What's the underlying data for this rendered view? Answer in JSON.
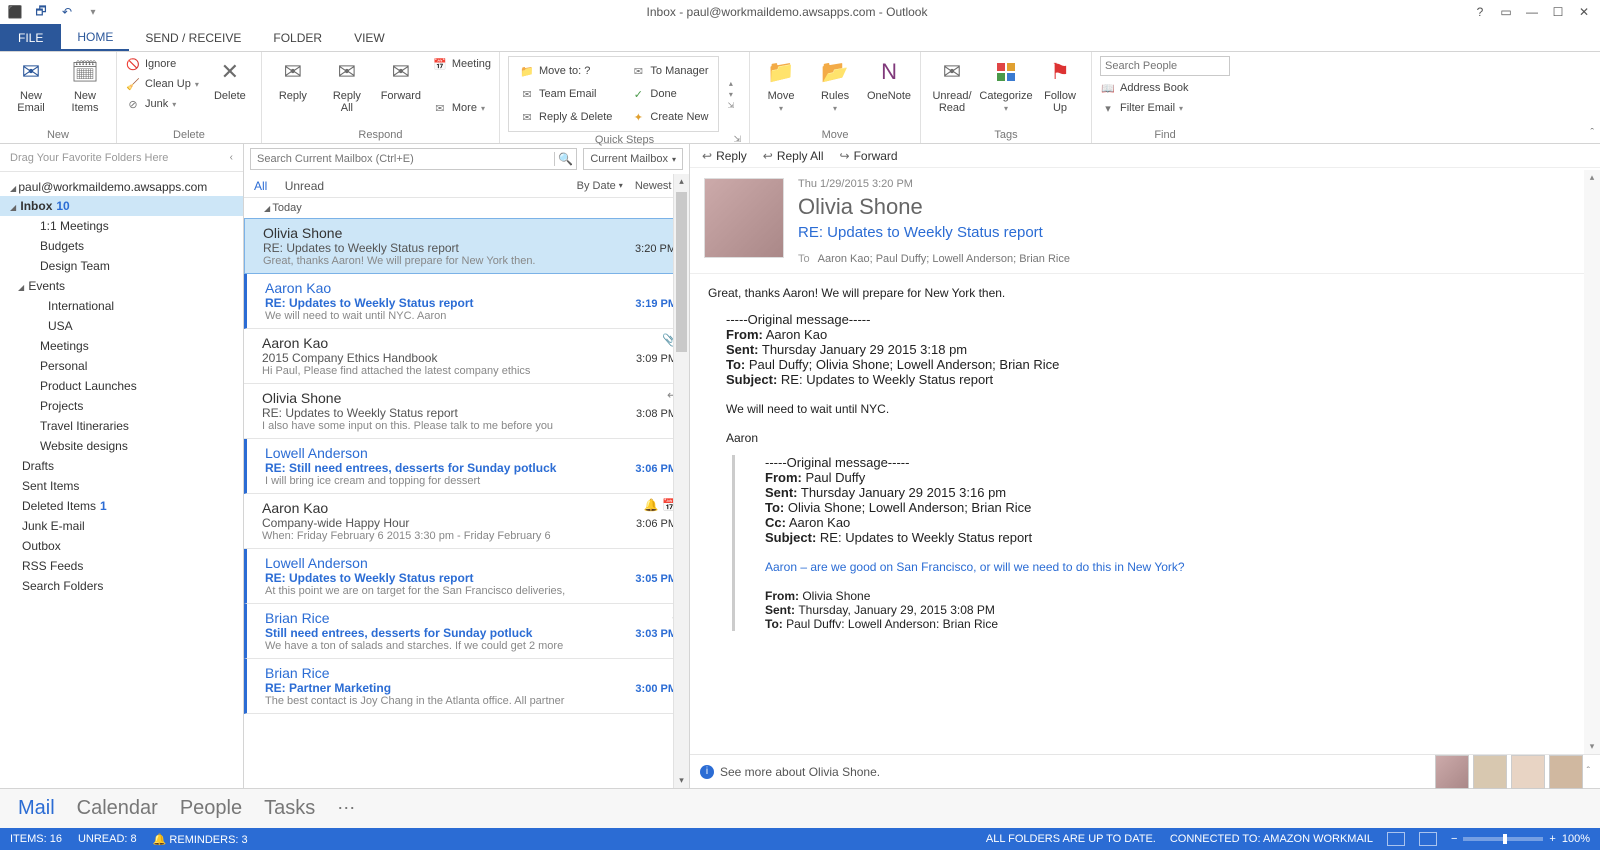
{
  "title": "Inbox - paul@workmaildemo.awsapps.com - Outlook",
  "tabs": {
    "file": "FILE",
    "home": "HOME",
    "sendrecv": "SEND / RECEIVE",
    "folder": "FOLDER",
    "view": "VIEW"
  },
  "ribbon": {
    "new": {
      "grp": "New",
      "email": "New\nEmail",
      "items": "New\nItems"
    },
    "delete": {
      "grp": "Delete",
      "ignore": "Ignore",
      "cleanup": "Clean Up",
      "junk": "Junk",
      "delete": "Delete"
    },
    "respond": {
      "grp": "Respond",
      "reply": "Reply",
      "replyall": "Reply\nAll",
      "forward": "Forward",
      "meeting": "Meeting",
      "more": "More"
    },
    "qs": {
      "grp": "Quick Steps",
      "move": "Move to: ?",
      "manager": "To Manager",
      "team": "Team Email",
      "done": "Done",
      "replydel": "Reply & Delete",
      "create": "Create New"
    },
    "move": {
      "grp": "Move",
      "move": "Move",
      "rules": "Rules",
      "onenote": "OneNote"
    },
    "tags": {
      "grp": "Tags",
      "unread": "Unread/\nRead",
      "cat": "Categorize",
      "follow": "Follow\nUp"
    },
    "find": {
      "grp": "Find",
      "searchph": "Search People",
      "addr": "Address Book",
      "filter": "Filter Email"
    }
  },
  "nav": {
    "fav": "Drag Your Favorite Folders Here",
    "account": "paul@workmaildemo.awsapps.com",
    "inbox": "Inbox",
    "inbox_cnt": "10",
    "subs": [
      "1:1 Meetings",
      "Budgets",
      "Design Team"
    ],
    "events": "Events",
    "events_children": [
      "International",
      "USA"
    ],
    "subs2": [
      "Meetings",
      "Personal",
      "Product Launches",
      "Projects",
      "Travel Itineraries",
      "Website designs"
    ],
    "drafts": "Drafts",
    "sent": "Sent Items",
    "deleted": "Deleted Items",
    "deleted_cnt": "1",
    "junk": "Junk E-mail",
    "outbox": "Outbox",
    "rss": "RSS Feeds",
    "search": "Search Folders"
  },
  "list": {
    "searchph": "Search Current Mailbox (Ctrl+E)",
    "scope": "Current Mailbox",
    "all": "All",
    "unread": "Unread",
    "bydate": "By Date",
    "newest": "Newest",
    "group": "Today",
    "msgs": [
      {
        "from": "Olivia Shone",
        "subj": "RE: Updates to Weekly Status report",
        "prev": "Great, thanks Aaron! We will prepare for New York then.",
        "time": "3:20 PM",
        "sel": true
      },
      {
        "from": "Aaron Kao",
        "subj": "RE: Updates to Weekly Status report",
        "prev": "We will need to wait until NYC.   Aaron",
        "time": "3:19 PM",
        "unread": true
      },
      {
        "from": "Aaron Kao",
        "subj": "2015 Company Ethics Handbook",
        "prev": "Hi Paul,  Please find attached the latest company ethics",
        "time": "3:09 PM",
        "badge": "📎"
      },
      {
        "from": "Olivia Shone",
        "subj": "RE: Updates to Weekly Status report",
        "prev": "I also have some input on this.  Please talk to me before you",
        "time": "3:08 PM",
        "badge": "↩"
      },
      {
        "from": "Lowell Anderson",
        "subj": "RE: Still need entrees, desserts for Sunday potluck",
        "prev": "I will bring ice cream and topping for dessert",
        "time": "3:06 PM",
        "unread": true
      },
      {
        "from": "Aaron Kao",
        "subj": "Company-wide Happy Hour",
        "prev": "When: Friday February 6 2015 3:30 pm - Friday February 6",
        "time": "3:06 PM",
        "badge": "🔔 📅"
      },
      {
        "from": "Lowell Anderson",
        "subj": "RE: Updates to Weekly Status report",
        "prev": "At this point we are on target for the San Francisco deliveries,",
        "time": "3:05 PM",
        "unread": true
      },
      {
        "from": "Brian Rice",
        "subj": "Still need entrees, desserts for Sunday potluck",
        "prev": "We have a ton of salads and starches. If we could get 2 more",
        "time": "3:03 PM",
        "unread": true,
        "badge": "↓"
      },
      {
        "from": "Brian Rice",
        "subj": "RE: Partner Marketing",
        "prev": "The best contact is Joy Chang in the Atlanta office. All partner",
        "time": "3:00 PM",
        "unread": true
      }
    ]
  },
  "reading": {
    "actions": {
      "reply": "Reply",
      "replyall": "Reply All",
      "forward": "Forward"
    },
    "date": "Thu 1/29/2015 3:20 PM",
    "sender": "Olivia Shone",
    "subject": "RE: Updates to Weekly Status report",
    "to_label": "To",
    "to": "Aaron Kao; Paul Duffy; Lowell Anderson; Brian Rice",
    "first": "Great, thanks Aaron! We will prepare for New York then.",
    "orig_hdr": "-----Original message-----",
    "q1_from_lbl": "From:",
    "q1_from": "Aaron Kao",
    "q1_sent_lbl": "Sent:",
    "q1_sent": "Thursday January 29 2015 3:18 pm",
    "q1_to_lbl": "To:",
    "q1_to": "Paul Duffy; Olivia Shone; Lowell Anderson; Brian Rice",
    "q1_subj_lbl": "Subject:",
    "q1_subj": "RE: Updates to Weekly Status report",
    "q1_body1": "We will need to wait until NYC.",
    "q1_body2": "Aaron",
    "q2_from_lbl": "From:",
    "q2_from": "Paul Duffy",
    "q2_sent_lbl": "Sent:",
    "q2_sent": "Thursday January 29 2015 3:16 pm",
    "q2_to_lbl": "To:",
    "q2_to": "Olivia Shone; Lowell Anderson; Brian Rice",
    "q2_cc_lbl": "Cc:",
    "q2_cc": "Aaron Kao",
    "q2_subj_lbl": "Subject:",
    "q2_subj": "RE: Updates to Weekly Status report",
    "q2_body": "Aaron – are we good on San Francisco, or will we need to do this in New York?",
    "q3_from_lbl": "From:",
    "q3_from": "Olivia Shone",
    "q3_sent_lbl": "Sent:",
    "q3_sent": "Thursday, January 29, 2015 3:08 PM",
    "q3_to_lbl": "To:",
    "q3_to": "Paul Duffv: Lowell Anderson: Brian Rice",
    "seemore": "See more about Olivia Shone."
  },
  "modules": {
    "mail": "Mail",
    "cal": "Calendar",
    "people": "People",
    "tasks": "Tasks"
  },
  "status": {
    "items": "ITEMS: 16",
    "unread": "UNREAD: 8",
    "rem": "REMINDERS: 3",
    "sync": "ALL FOLDERS ARE UP TO DATE.",
    "conn": "CONNECTED TO: AMAZON WORKMAIL",
    "zoom": "100%"
  }
}
